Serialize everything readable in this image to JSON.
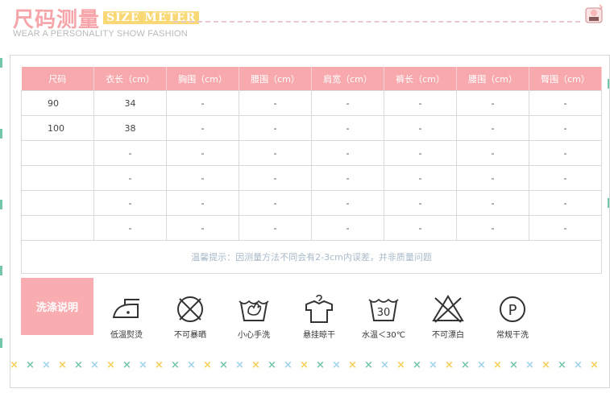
{
  "header": {
    "title_cn": "尺码测量",
    "title_en": "SIZE METER",
    "subtitle": "WEAR A PERSONALITY SHOW FASHION"
  },
  "size_table": {
    "headers": [
      "尺码",
      "衣长（cm）",
      "胸围（cm）",
      "腰围（cm）",
      "肩宽（cm）",
      "裤长（cm）",
      "腰围（cm）",
      "臀围（cm）"
    ],
    "rows": [
      [
        "90",
        "34",
        "-",
        "-",
        "-",
        "-",
        "-",
        "-"
      ],
      [
        "100",
        "38",
        "-",
        "-",
        "-",
        "-",
        "-",
        "-"
      ],
      [
        "",
        "-",
        "-",
        "-",
        "-",
        "-",
        "-",
        "-"
      ],
      [
        "",
        "-",
        "-",
        "-",
        "-",
        "-",
        "-",
        "-"
      ],
      [
        "",
        "-",
        "-",
        "-",
        "-",
        "-",
        "-",
        "-"
      ],
      [
        "",
        "-",
        "-",
        "-",
        "-",
        "-",
        "-",
        "-"
      ]
    ],
    "tip": "温馨提示：因测量方法不同会有2-3cm内误差，并非质量问题"
  },
  "care": {
    "title": "洗涤说明",
    "items": [
      {
        "icon": "iron-low-icon",
        "label": "低温熨烫"
      },
      {
        "icon": "no-sun-icon",
        "label": "不可暴晒"
      },
      {
        "icon": "hand-wash-icon",
        "label": "小心手洗"
      },
      {
        "icon": "hang-dry-icon",
        "label": "悬挂晾干"
      },
      {
        "icon": "wash-30-icon",
        "label": "水温＜30℃",
        "temp": "30"
      },
      {
        "icon": "no-bleach-icon",
        "label": "不可漂白"
      },
      {
        "icon": "dry-clean-icon",
        "label": "常规干洗",
        "letter": "P"
      }
    ]
  },
  "colors": {
    "pink": "#f8a9ad",
    "green": "#74c6a8",
    "yellow": "#f5cf55",
    "blue": "#9fd3ef"
  }
}
